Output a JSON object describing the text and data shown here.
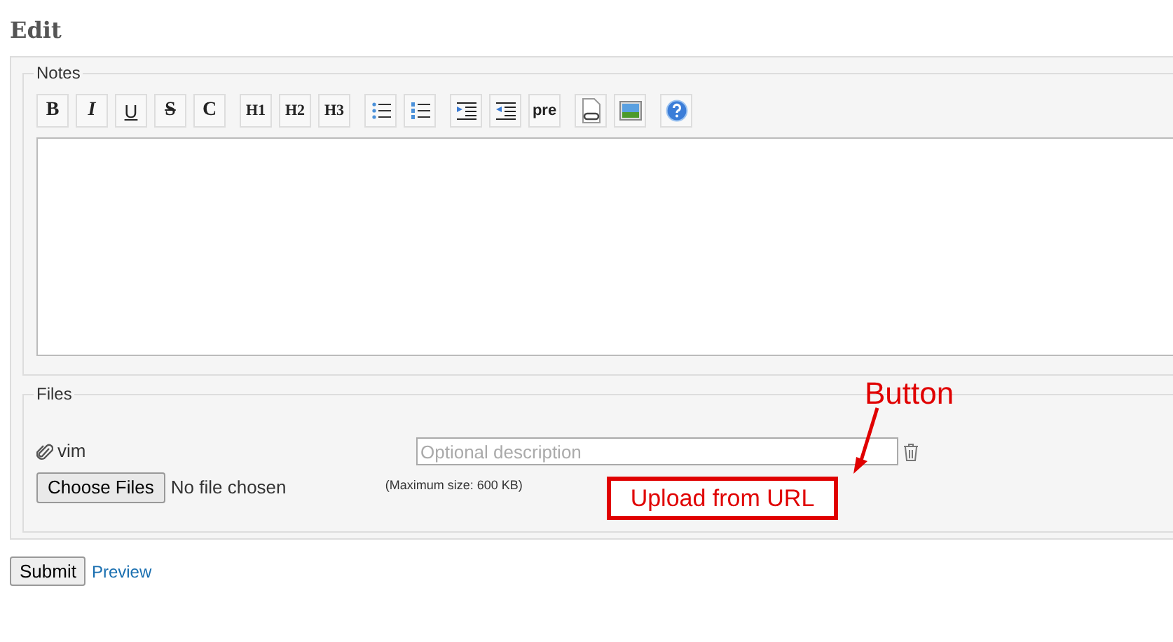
{
  "heading": "Edit",
  "notes": {
    "legend": "Notes",
    "toolbar_groups": [
      [
        {
          "kind": "bold",
          "label": "B"
        },
        {
          "kind": "italic",
          "label": "I"
        },
        {
          "kind": "underline",
          "label": "U"
        },
        {
          "kind": "strike",
          "label": "S"
        },
        {
          "kind": "bold",
          "label": "C"
        }
      ],
      [
        {
          "kind": "heading",
          "label": "H1"
        },
        {
          "kind": "heading",
          "label": "H2"
        },
        {
          "kind": "heading",
          "label": "H3"
        }
      ],
      [
        {
          "kind": "bulletlist"
        },
        {
          "kind": "numberlist"
        }
      ],
      [
        {
          "kind": "indent"
        },
        {
          "kind": "outdent"
        },
        {
          "kind": "code",
          "label": "pre"
        }
      ],
      [
        {
          "kind": "filelink"
        },
        {
          "kind": "image"
        }
      ],
      [
        {
          "kind": "help"
        }
      ]
    ]
  },
  "files": {
    "legend": "Files",
    "attachment": "vim",
    "description_placeholder": "Optional description",
    "choose_button": "Choose Files",
    "chosen": "No file chosen",
    "max_size": "(Maximum size: 600 KB)"
  },
  "annotation": {
    "label": "Button",
    "boxed_text": "Upload from URL"
  },
  "actions": {
    "submit": "Submit",
    "preview": "Preview"
  }
}
